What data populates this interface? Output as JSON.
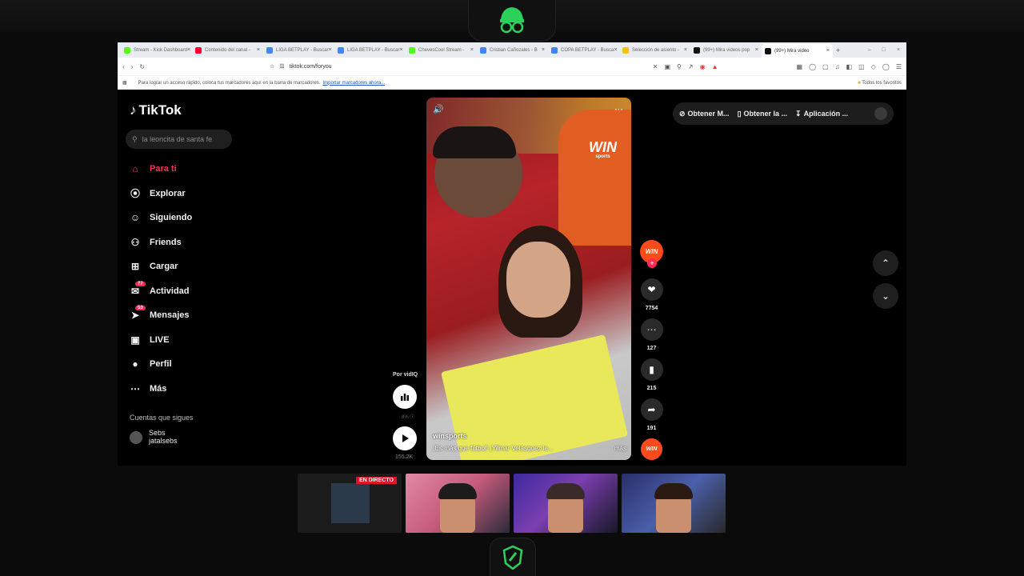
{
  "browser": {
    "tabs": [
      {
        "label": "Stream - Kick Dashboard",
        "color": "#53fc18"
      },
      {
        "label": "Contenido del canal -",
        "color": "#ff0033"
      },
      {
        "label": "LIGA BETPLAY - Buscar",
        "color": "#4285f4"
      },
      {
        "label": "LIGA BETPLAY - Buscar",
        "color": "#4285f4"
      },
      {
        "label": "ChevesCool Stream -",
        "color": "#53fc18"
      },
      {
        "label": "Cristian Cañozales - B",
        "color": "#4285f4"
      },
      {
        "label": "COPA BETPLAY - Busca",
        "color": "#4285f4"
      },
      {
        "label": "Selección de asiento -",
        "color": "#f4c20d"
      },
      {
        "label": "(99+) Mira videos pop",
        "color": "#111111"
      },
      {
        "label": "(99+) Mira video",
        "color": "#111111"
      }
    ],
    "url": "tiktok.com/foryou",
    "bookmarks_hint": "Para lograr un acceso rápido, coloca tus marcadores aquí en la barra de marcadores.",
    "bookmarks_link": "Importar marcadores ahora...",
    "all_favorites": "Todos los favoritos"
  },
  "tiktok": {
    "logo": "TikTok",
    "search_placeholder": "la leoncita de santa fe",
    "nav": [
      {
        "label": "Para ti",
        "icon": "home-icon",
        "active": true
      },
      {
        "label": "Explorar",
        "icon": "compass-icon"
      },
      {
        "label": "Siguiendo",
        "icon": "user-follow-icon"
      },
      {
        "label": "Friends",
        "icon": "friends-icon"
      },
      {
        "label": "Cargar",
        "icon": "upload-icon"
      },
      {
        "label": "Actividad",
        "icon": "activity-icon",
        "badge": "77"
      },
      {
        "label": "Mensajes",
        "icon": "messages-icon",
        "badge": "53"
      },
      {
        "label": "LIVE",
        "icon": "live-icon"
      },
      {
        "label": "Perfil",
        "icon": "profile-icon"
      },
      {
        "label": "Más",
        "icon": "more-icon"
      }
    ],
    "following_title": "Cuentas que sigues",
    "following_account": "Sebs",
    "following_account_handle": "jatalsebs",
    "topbar": {
      "btn1": "Obtener M...",
      "btn2": "Obtener la ...",
      "btn3": "Aplicación ..."
    },
    "video": {
      "win_logo": "WIN",
      "win_sub": "sports",
      "username": "winsports",
      "caption": "¡Es más que fútbol! ¡Yilmar Velásquez le...",
      "more": "más"
    },
    "vidiq": {
      "label": "Por vidIQ",
      "pct": "8%",
      "play_count": "155.2K"
    },
    "actions": {
      "likes": "7754",
      "comments": "127",
      "saves": "215",
      "shares": "191"
    }
  },
  "webcams": {
    "live_badge": "EN DIRECTO"
  }
}
